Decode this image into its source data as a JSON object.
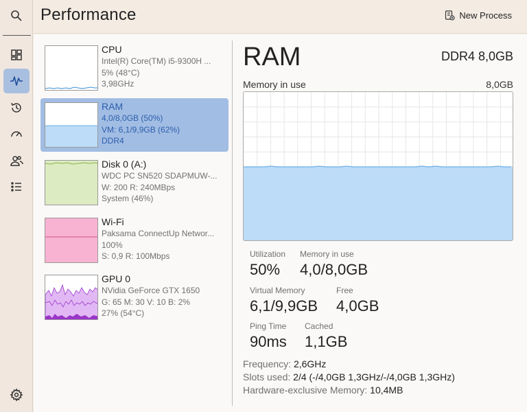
{
  "header": {
    "title": "Performance",
    "new_process_label": "New Process"
  },
  "rail": {
    "items": [
      {
        "icon": "search-icon"
      },
      {
        "icon": "dashboard-icon"
      },
      {
        "icon": "performance-icon",
        "active": true
      },
      {
        "icon": "history-icon"
      },
      {
        "icon": "gauge-icon"
      },
      {
        "icon": "users-icon"
      },
      {
        "icon": "list-icon"
      },
      {
        "icon": "settings-icon"
      }
    ]
  },
  "devices": [
    {
      "name": "CPU",
      "l1": "Intel(R) Core(TM) i5-9300H ...",
      "l2": "5% (48°C)",
      "l3": "3,98GHz"
    },
    {
      "name": "RAM",
      "l1": "4,0/8,0GB (50%)",
      "l2": "VM: 6,1/9,9GB (62%)",
      "l3": "DDR4"
    },
    {
      "name": "Disk 0 (A:)",
      "l1": "WDC PC SN520 SDAPMUW-...",
      "l2": "W: 200 R: 240MBps",
      "l3": "System (46%)"
    },
    {
      "name": "Wi-Fi",
      "l1": "Paksama ConnectUp Networ...",
      "l2": "100%",
      "l3": "S: 0,9 R: 100Mbps"
    },
    {
      "name": "GPU 0",
      "l1": "NVidia GeForce GTX 1650",
      "l2": "G: 65 M: 30 V: 10 B: 2%",
      "l3": "27% (54°C)"
    }
  ],
  "detail": {
    "title": "RAM",
    "type": "DDR4 8,0GB",
    "graph_label": "Memory in use",
    "graph_max": "8,0GB",
    "usage_fraction": 0.5,
    "stats": {
      "utilization_label": "Utilization",
      "utilization_value": "50%",
      "memory_in_use_label": "Memory in use",
      "memory_in_use_value": "4,0/8,0GB",
      "virtual_memory_label": "Virtual Memory",
      "virtual_memory_value": "6,1/9,9GB",
      "free_label": "Free",
      "free_value": "4,0GB",
      "ping_time_label": "Ping Time",
      "ping_time_value": "90ms",
      "cached_label": "Cached",
      "cached_value": "1,1GB"
    },
    "info": {
      "frequency_label": "Frequency:",
      "frequency_value": "2,6GHz",
      "slots_label": "Slots used:",
      "slots_value": "2/4 (-/4,0GB 1,3GHz/-/4,0GB 1,3GHz)",
      "hw_label": "Hardware-exclusive Memory:",
      "hw_value": "10,4MB"
    }
  },
  "colors": {
    "cpu_line": "#3a8fd1",
    "ram_fill": "#bcdcf7",
    "ram_line": "#6aaee6",
    "disk_fill": "#dcebc1",
    "disk_line": "#8ab04a",
    "wifi_fill": "#f8b3d2",
    "wifi_line": "#d0508c",
    "gpu_fill": "#e1b8f4",
    "gpu_line": "#9b35c9",
    "selected_bg": "#a2bde3",
    "selected_text": "#2c5fae"
  }
}
